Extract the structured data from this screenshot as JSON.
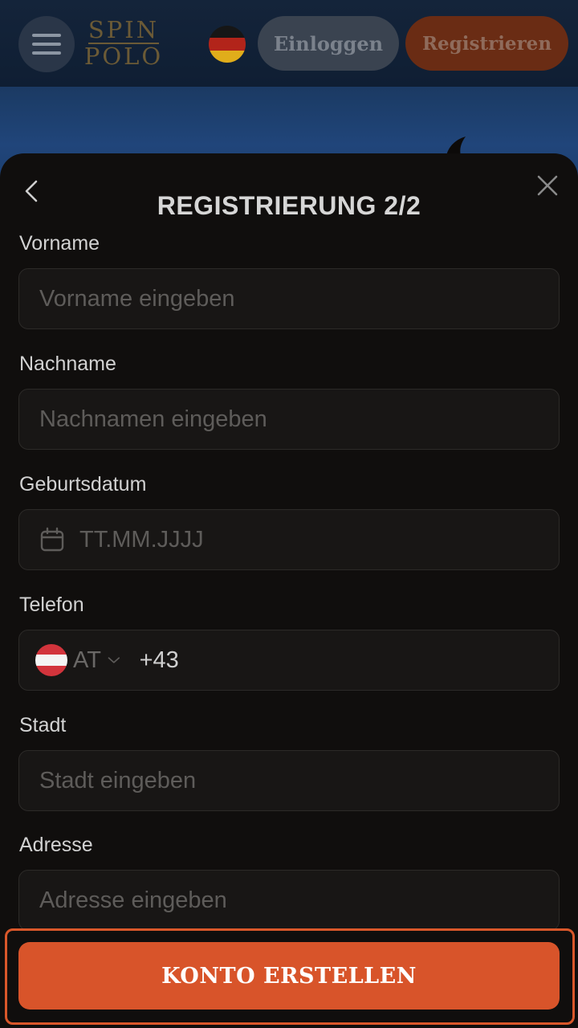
{
  "header": {
    "logo_line1": "SPIN",
    "logo_line2": "POLO",
    "login_label": "Einloggen",
    "register_label": "Registrieren",
    "language_flag": "flag-de-icon"
  },
  "modal": {
    "title": "REGISTRIERUNG 2/2",
    "fields": {
      "firstname": {
        "label": "Vorname",
        "placeholder": "Vorname eingeben",
        "value": ""
      },
      "lastname": {
        "label": "Nachname",
        "placeholder": "Nachnamen eingeben",
        "value": ""
      },
      "birthdate": {
        "label": "Geburtsdatum",
        "placeholder": "TT.MM.JJJJ",
        "value": ""
      },
      "phone": {
        "label": "Telefon",
        "country_code": "AT",
        "prefix": "+43",
        "value": ""
      },
      "city": {
        "label": "Stadt",
        "placeholder": "Stadt eingeben",
        "value": ""
      },
      "address": {
        "label": "Adresse",
        "placeholder": "Adresse eingeben",
        "value": ""
      }
    },
    "submit_label": "KONTO ERSTELLEN"
  },
  "colors": {
    "accent": "#d8542a",
    "sheet_background": "#100e0d",
    "field_background": "#181615"
  }
}
